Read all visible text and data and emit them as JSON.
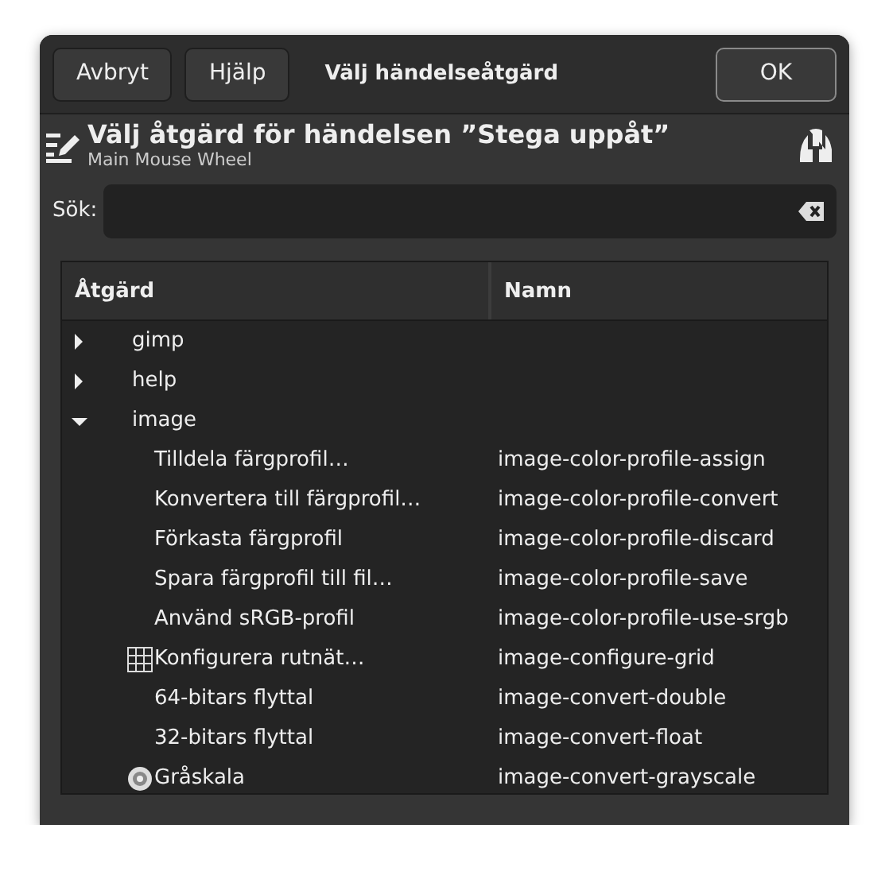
{
  "header_bar": {
    "buttons": [
      "Avbryt",
      "Hjälp"
    ],
    "title": "Välj händelseåtgärd",
    "ok_button": "OK"
  },
  "heading": {
    "title": "Välj åtgärd för händelsen ”Stega uppåt”",
    "subtitle": "Main Mouse Wheel"
  },
  "search": {
    "label": "Sök:"
  },
  "tree": {
    "columns": [
      "Åtgärd",
      "Namn"
    ],
    "rows": [
      {
        "action": "gimp",
        "expanded": false
      },
      {
        "action": "help",
        "expanded": false
      },
      {
        "action": "image",
        "expanded": true,
        "children": [
          {
            "kind": "plain",
            "action": "Tilldela färgprofil…",
            "name": "image-color-profile-assign"
          },
          {
            "kind": "plain",
            "action": "Konvertera till färgprofil…",
            "name": "image-color-profile-convert"
          },
          {
            "kind": "plain",
            "action": "Förkasta färgprofil",
            "name": "image-color-profile-discard"
          },
          {
            "kind": "plain",
            "action": "Spara färgprofil till fil…",
            "name": "image-color-profile-save"
          },
          {
            "kind": "plain",
            "action": "Använd sRGB-profil",
            "name": "image-color-profile-use-srgb"
          },
          {
            "kind": "grid",
            "action": "Konfigurera rutnät…",
            "name": "image-configure-grid"
          },
          {
            "kind": "plain",
            "action": "64-bitars flyttal",
            "name": "image-convert-double"
          },
          {
            "kind": "plain",
            "action": "32-bitars flyttal",
            "name": "image-convert-float"
          },
          {
            "kind": "grayscale",
            "action": "Gråskala",
            "name": "image-convert-grayscale"
          }
        ]
      }
    ]
  }
}
